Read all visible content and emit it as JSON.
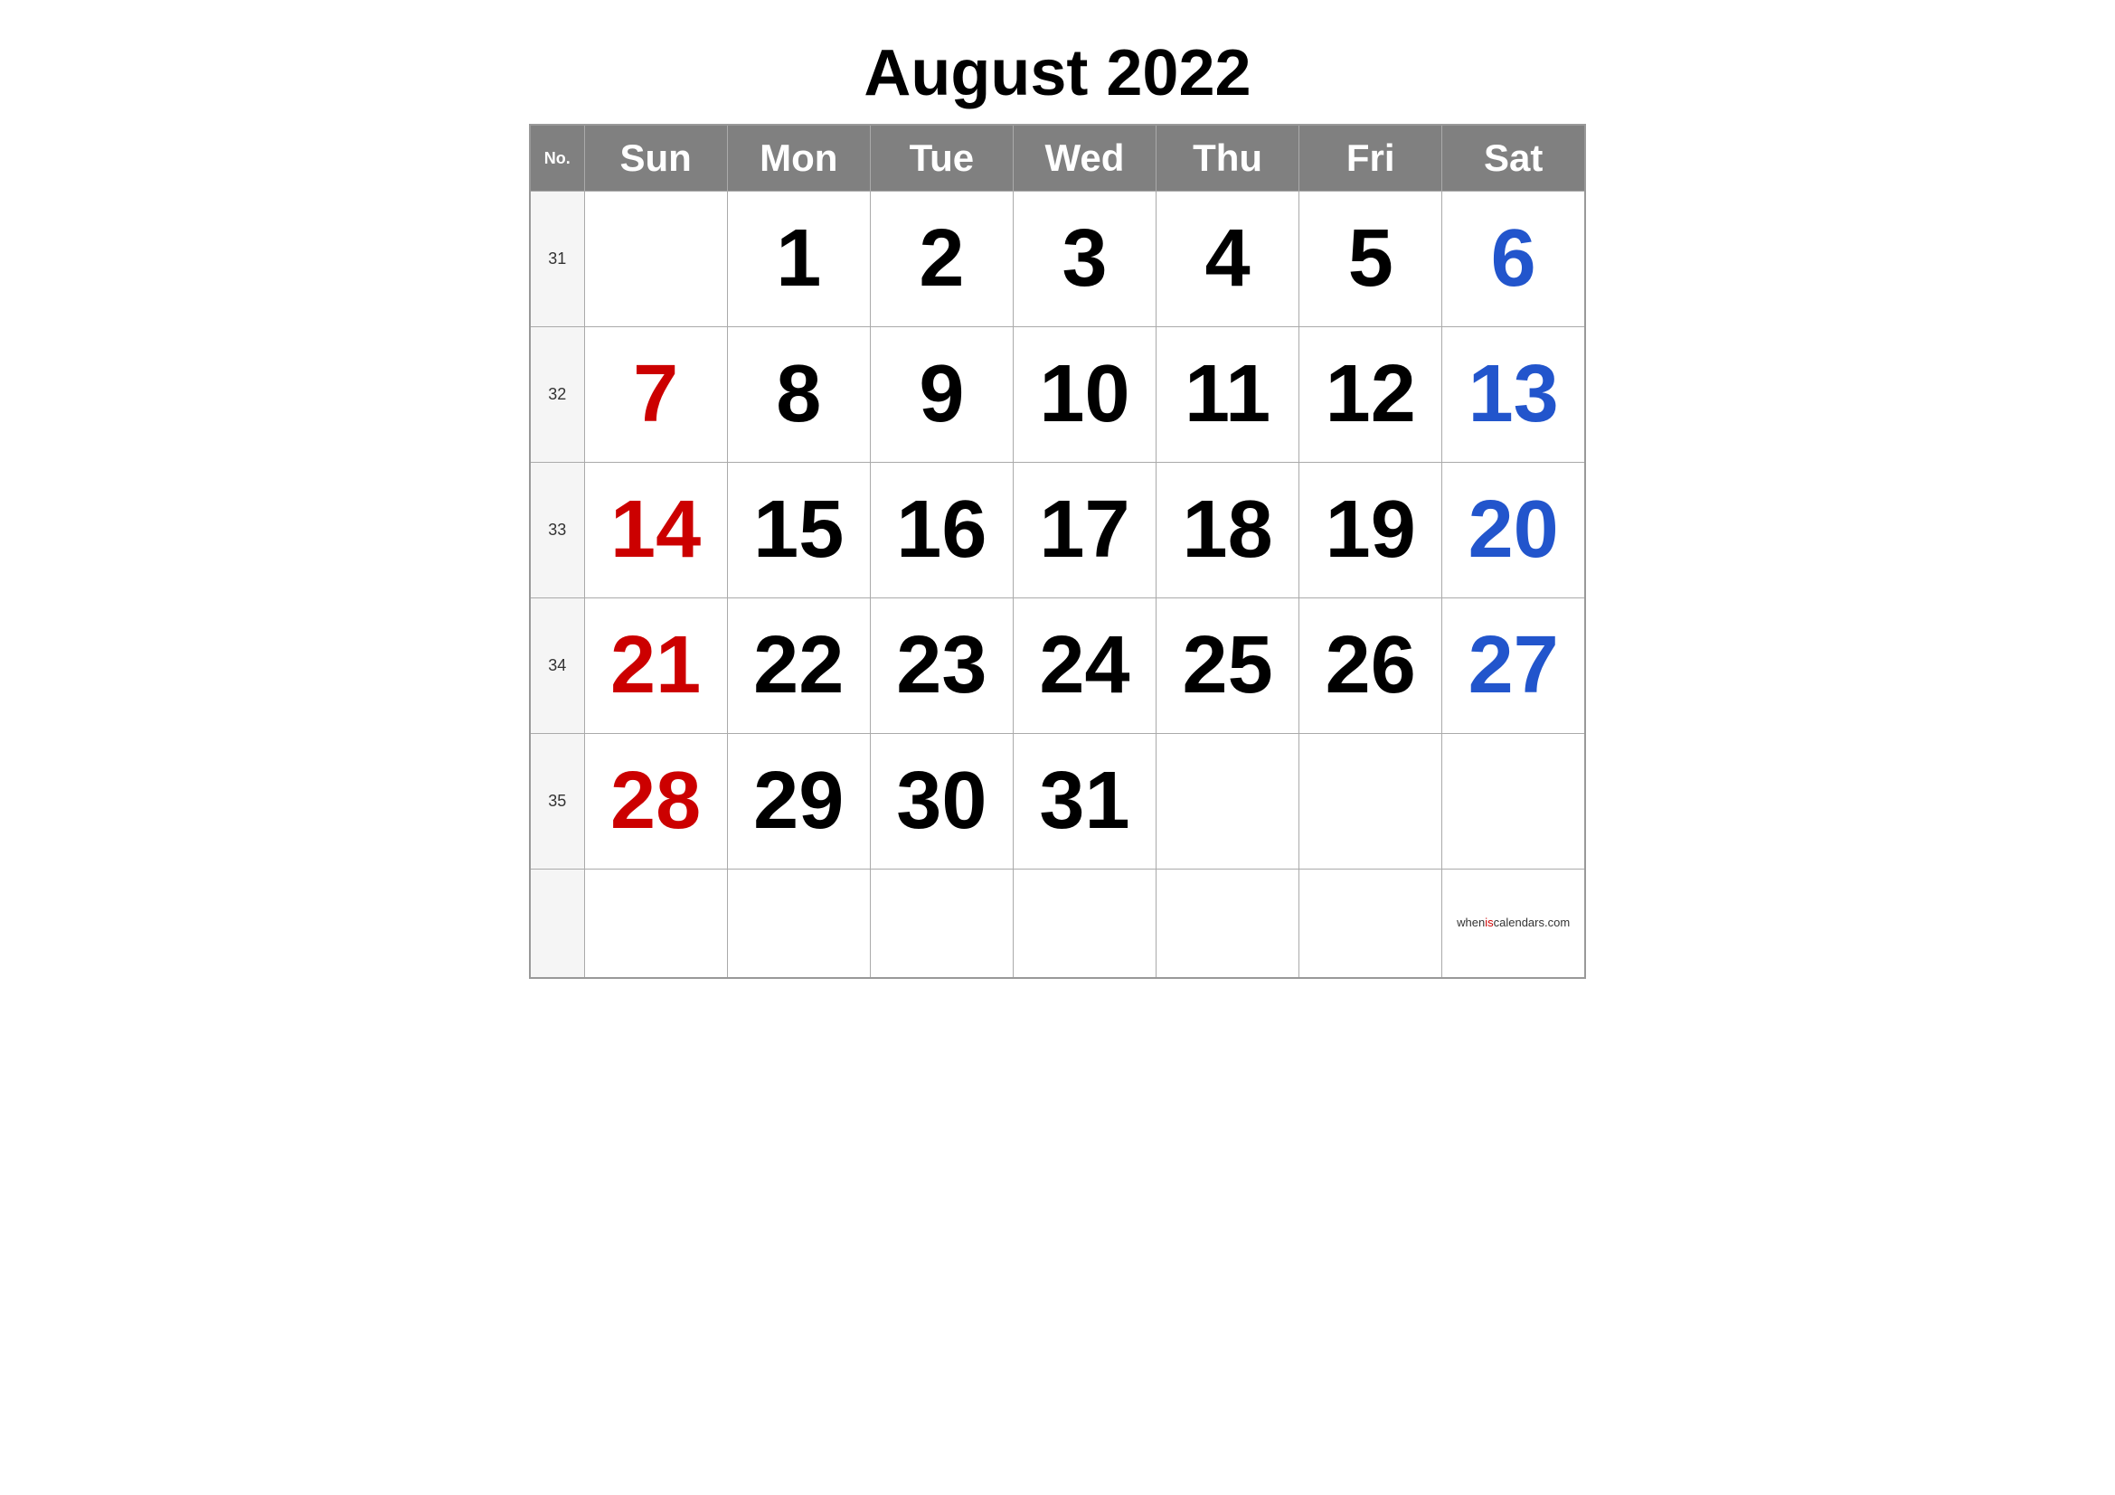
{
  "title": "August 2022",
  "header": {
    "no_label": "No.",
    "days": [
      "Sun",
      "Mon",
      "Tue",
      "Wed",
      "Thu",
      "Fri",
      "Sat"
    ]
  },
  "weeks": [
    {
      "week_no": "31",
      "days": [
        {
          "day": "",
          "type": "empty"
        },
        {
          "day": "1",
          "type": "weekday"
        },
        {
          "day": "2",
          "type": "weekday"
        },
        {
          "day": "3",
          "type": "weekday"
        },
        {
          "day": "4",
          "type": "weekday"
        },
        {
          "day": "5",
          "type": "weekday"
        },
        {
          "day": "6",
          "type": "saturday"
        }
      ]
    },
    {
      "week_no": "32",
      "days": [
        {
          "day": "7",
          "type": "sunday"
        },
        {
          "day": "8",
          "type": "weekday"
        },
        {
          "day": "9",
          "type": "weekday"
        },
        {
          "day": "10",
          "type": "weekday"
        },
        {
          "day": "11",
          "type": "weekday"
        },
        {
          "day": "12",
          "type": "weekday"
        },
        {
          "day": "13",
          "type": "saturday"
        }
      ]
    },
    {
      "week_no": "33",
      "days": [
        {
          "day": "14",
          "type": "sunday"
        },
        {
          "day": "15",
          "type": "weekday"
        },
        {
          "day": "16",
          "type": "weekday"
        },
        {
          "day": "17",
          "type": "weekday"
        },
        {
          "day": "18",
          "type": "weekday"
        },
        {
          "day": "19",
          "type": "weekday"
        },
        {
          "day": "20",
          "type": "saturday"
        }
      ]
    },
    {
      "week_no": "34",
      "days": [
        {
          "day": "21",
          "type": "sunday"
        },
        {
          "day": "22",
          "type": "weekday"
        },
        {
          "day": "23",
          "type": "weekday"
        },
        {
          "day": "24",
          "type": "weekday"
        },
        {
          "day": "25",
          "type": "weekday"
        },
        {
          "day": "26",
          "type": "weekday"
        },
        {
          "day": "27",
          "type": "saturday"
        }
      ]
    },
    {
      "week_no": "35",
      "days": [
        {
          "day": "28",
          "type": "sunday"
        },
        {
          "day": "29",
          "type": "weekday"
        },
        {
          "day": "30",
          "type": "weekday"
        },
        {
          "day": "31",
          "type": "weekday"
        },
        {
          "day": "",
          "type": "empty"
        },
        {
          "day": "",
          "type": "empty"
        },
        {
          "day": "",
          "type": "empty"
        }
      ]
    }
  ],
  "watermark": {
    "prefix": "when",
    "highlight": "is",
    "suffix": "calendars.com"
  }
}
